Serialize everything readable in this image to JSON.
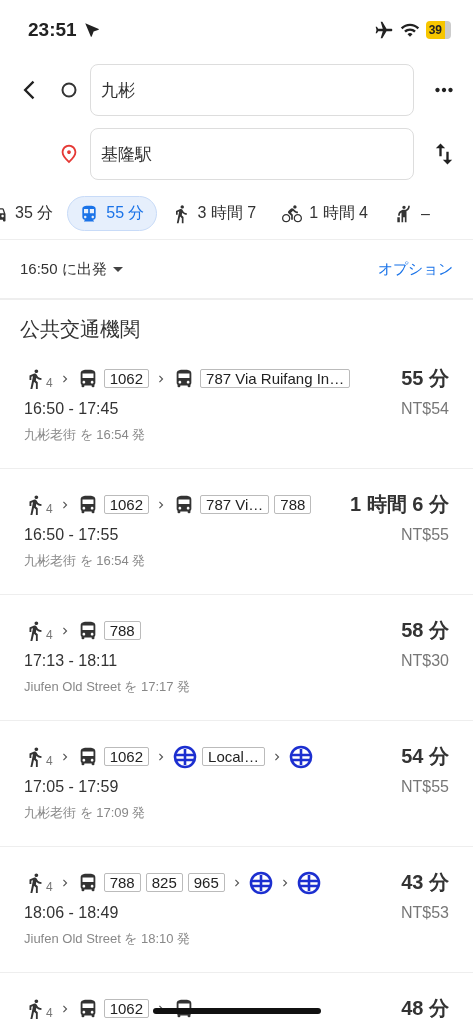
{
  "status_bar": {
    "time": "23:51",
    "battery": "39"
  },
  "search": {
    "origin": "九彬",
    "destination": "基隆駅"
  },
  "modes": [
    {
      "kind": "car",
      "label": "35 分",
      "selected": false
    },
    {
      "kind": "transit",
      "label": "55 分",
      "selected": true
    },
    {
      "kind": "walk",
      "label": "3 時間 7",
      "selected": false
    },
    {
      "kind": "bike",
      "label": "1 時間 4",
      "selected": false
    },
    {
      "kind": "hail",
      "label": "–",
      "selected": false
    }
  ],
  "departure_bar": {
    "time": "16:50 に出発",
    "options": "オプション"
  },
  "section_title": "公共交通機関",
  "routes": [
    {
      "segments": [
        {
          "kind": "walk",
          "sub": "4"
        },
        {
          "kind": "bus",
          "tags": [
            "1062"
          ]
        },
        {
          "kind": "bus",
          "tags": [
            "787 Via Ruifang In…"
          ]
        }
      ],
      "duration": "55 分",
      "times": "16:50 - 17:45",
      "fare": "NT$54",
      "departure": "九彬老街 を 16:54 発"
    },
    {
      "segments": [
        {
          "kind": "walk",
          "sub": "4"
        },
        {
          "kind": "bus",
          "tags": [
            "1062"
          ]
        },
        {
          "kind": "bus",
          "tags": [
            "787 Vi…",
            "788"
          ]
        }
      ],
      "duration": "1 時間 6 分",
      "times": "16:50 - 17:55",
      "fare": "NT$55",
      "departure": "九彬老街 を 16:54 発"
    },
    {
      "segments": [
        {
          "kind": "walk",
          "sub": "4"
        },
        {
          "kind": "bus",
          "tags": [
            "788"
          ]
        }
      ],
      "duration": "58 分",
      "times": "17:13 - 18:11",
      "fare": "NT$30",
      "departure": "Jiufen Old Street を 17:17 発"
    },
    {
      "segments": [
        {
          "kind": "walk",
          "sub": "4"
        },
        {
          "kind": "bus",
          "tags": [
            "1062"
          ]
        },
        {
          "kind": "train",
          "tags": [
            "Local…"
          ]
        },
        {
          "kind": "train"
        }
      ],
      "duration": "54 分",
      "times": "17:05 - 17:59",
      "fare": "NT$55",
      "departure": "九彬老街 を 17:09 発"
    },
    {
      "segments": [
        {
          "kind": "walk",
          "sub": "4"
        },
        {
          "kind": "bus",
          "tags": [
            "788",
            "825",
            "965"
          ]
        },
        {
          "kind": "train"
        },
        {
          "kind": "train"
        }
      ],
      "duration": "43 分",
      "times": "18:06 - 18:49",
      "fare": "NT$53",
      "departure": "Jiufen Old Street を 18:10 発"
    },
    {
      "segments": [
        {
          "kind": "walk",
          "sub": "4"
        },
        {
          "kind": "bus",
          "tags": [
            "1062"
          ]
        },
        {
          "kind": "bus"
        }
      ],
      "duration": "48 分"
    }
  ]
}
